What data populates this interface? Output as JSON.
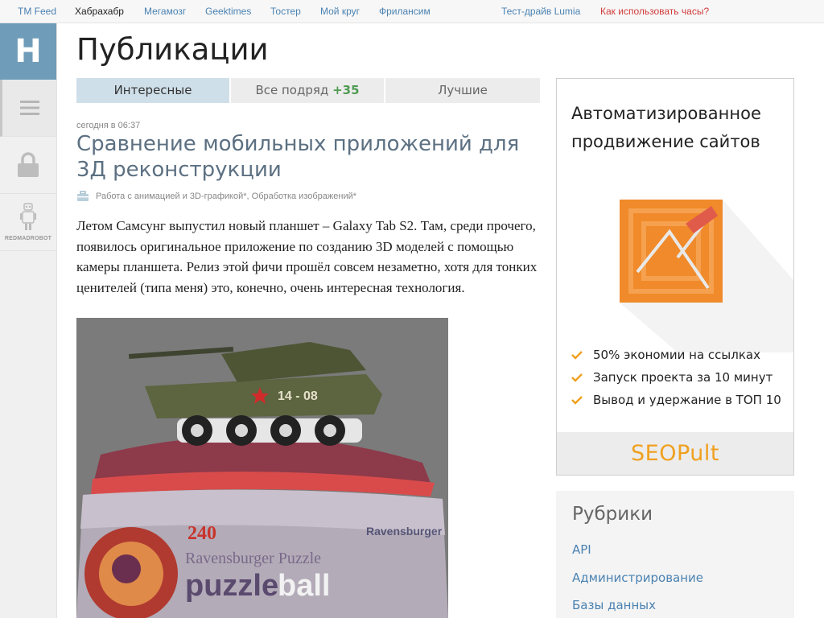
{
  "topnav": {
    "links": [
      {
        "label": "TM Feed"
      },
      {
        "label": "Хабрахабр"
      },
      {
        "label": "Мегамозг"
      },
      {
        "label": "Geektimes"
      },
      {
        "label": "Тостер"
      },
      {
        "label": "Мой круг"
      },
      {
        "label": "Фрилансим"
      }
    ],
    "promo": [
      {
        "label": "Тест-драйв Lumia"
      },
      {
        "label": "Как использовать часы?"
      }
    ]
  },
  "sidebar": {
    "logo_letter": "H",
    "menu_icon": "hamburger-icon",
    "lock_icon": "lock-icon",
    "sponsor_label": "REDMADROBOT"
  },
  "page": {
    "title": "Публикации"
  },
  "tabs": [
    {
      "label": "Интересные",
      "active": true
    },
    {
      "label": "Все подряд",
      "count": "+35"
    },
    {
      "label": "Лучшие"
    }
  ],
  "post": {
    "time": "сегодня в 06:37",
    "title": "Сравнение мобильных приложений для 3Д реконструкции",
    "hubs": "Работа с анимацией и 3D-графикой*, Обработка изображений*",
    "body": "Летом Самсунг выпустил новый планшет – Galaxy Tab S2. Там, среди прочего, появилось оригинальное приложение по созданию 3D моделей с помощью камеры планшета. Релиз этой фичи прошёл совсем незаметно, хотя для тонких ценителей (типа меня) это, конечно, очень интересная технология.",
    "image": {
      "tank_marking": "14 - 08",
      "box_number": "240",
      "box_brand": "Ravensburger",
      "box_subtitle": "Ravensburger Puzzle",
      "box_product_a": "puzzle",
      "box_product_b": "ball"
    }
  },
  "ad": {
    "title": "Автоматизированное продвижение сайтов",
    "features": [
      "50% экономии на ссылках",
      "Запуск проекта за 10 минут",
      "Вывод и удержание в ТОП 10"
    ],
    "brand": "SEOPult",
    "colors": {
      "accent": "#f0a020",
      "graphic": "#f08a2a"
    }
  },
  "rubrics": {
    "title": "Рубрики",
    "items": [
      "API",
      "Администрирование",
      "Базы данных"
    ]
  }
}
